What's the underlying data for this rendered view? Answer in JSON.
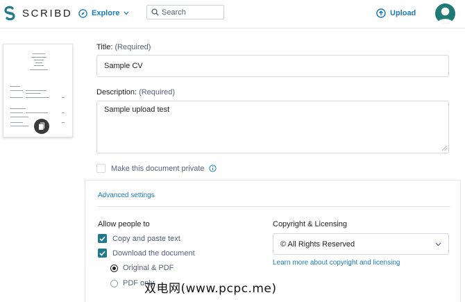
{
  "header": {
    "brand": "SCRIBD",
    "explore_label": "Explore",
    "search_placeholder": "Search",
    "upload_label": "Upload"
  },
  "form": {
    "title_label": "Title:",
    "title_required": "(Required)",
    "title_value": "Sample CV",
    "description_label": "Description:",
    "description_required": "(Required)",
    "description_value": "Sample upload test",
    "private_label": "Make this document private"
  },
  "advanced": {
    "link_label": "Advanced settings",
    "allow_heading": "Allow people to",
    "copy_text_label": "Copy and paste text",
    "download_label": "Download the document",
    "original_pdf_label": "Original & PDF",
    "pdf_only_label": "PDF only",
    "copyright_heading": "Copyright & Licensing",
    "license_selected": "© All Rights Reserved",
    "learn_more_label": "Learn more about copyright and licensing"
  },
  "watermark": "双电网(www.pcpc.me)",
  "colors": {
    "accent_blue": "#1a7bba",
    "checkbox_teal": "#1e7a8c",
    "avatar_teal": "#1e7a75"
  }
}
